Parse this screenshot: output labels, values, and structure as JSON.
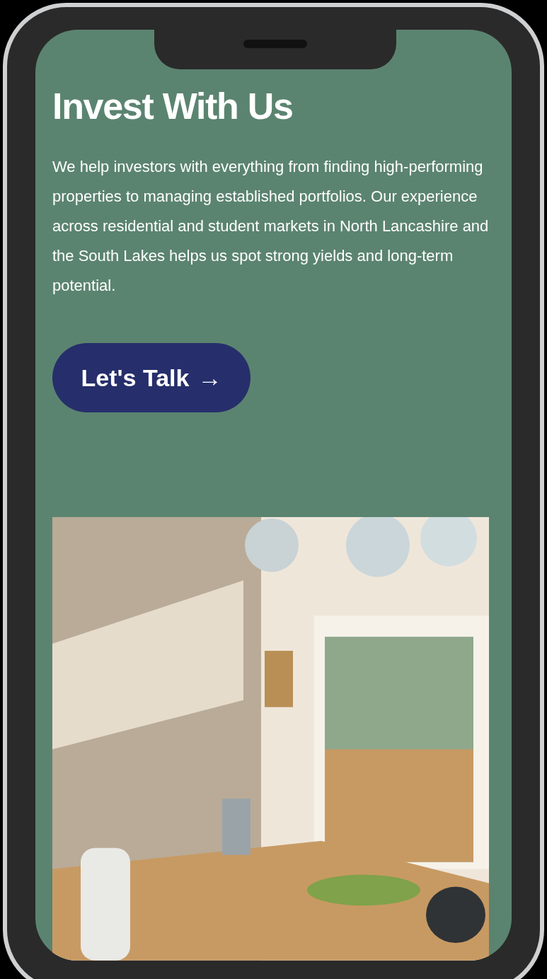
{
  "heading": "Invest With Us",
  "body": "We help investors with everything from finding high-performing properties to managing established portfolios. Our experience across residential and student markets in North Lancashire and the South Lakes helps us spot strong yields and long-term potential.",
  "cta": {
    "label": "Let's Talk",
    "arrow": "→"
  }
}
